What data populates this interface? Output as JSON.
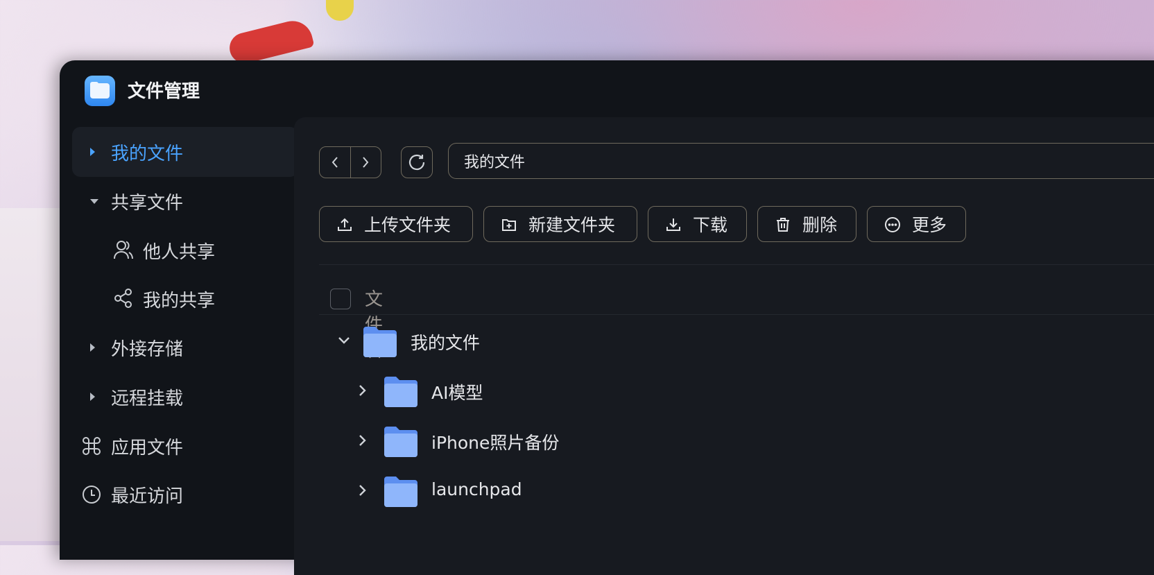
{
  "app": {
    "title": "文件管理"
  },
  "sidebar": {
    "items": [
      {
        "label": "我的文件",
        "state": "collapsed",
        "active": true
      },
      {
        "label": "共享文件",
        "state": "expanded"
      },
      {
        "label": "他人共享",
        "icon": "users-icon"
      },
      {
        "label": "我的共享",
        "icon": "share-icon"
      },
      {
        "label": "外接存储",
        "state": "collapsed"
      },
      {
        "label": "远程挂载",
        "state": "collapsed"
      },
      {
        "label": "应用文件",
        "icon": "command-icon"
      },
      {
        "label": "最近访问",
        "icon": "clock-icon"
      }
    ]
  },
  "path": {
    "value": "我的文件"
  },
  "toolbar": {
    "upload_folder": "上传文件夹",
    "new_folder": "新建文件夹",
    "download": "下载",
    "delete": "删除",
    "more": "更多"
  },
  "table": {
    "columns": [
      "文件名"
    ],
    "rows": [
      {
        "name": "我的文件",
        "expanded": true,
        "level": 0
      },
      {
        "name": "AI模型",
        "expanded": false,
        "level": 1
      },
      {
        "name": "iPhone照片备份",
        "expanded": false,
        "level": 1
      },
      {
        "name": "launchpad",
        "expanded": false,
        "level": 1
      }
    ]
  },
  "colors": {
    "accent": "#4aa3ff",
    "folder": "#7aa7f5",
    "window_bg": "#111419",
    "border": "#6f6a5d"
  }
}
